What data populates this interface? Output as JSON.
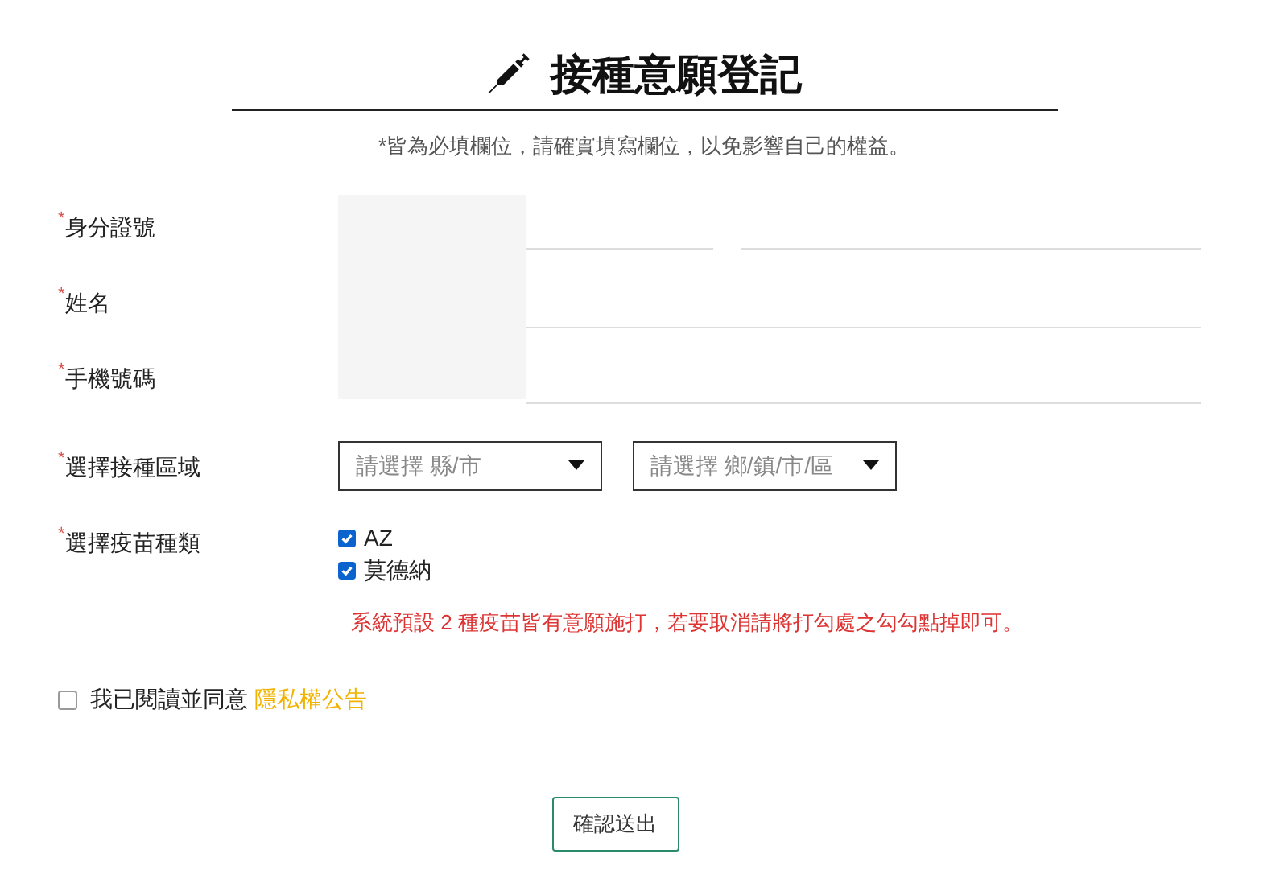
{
  "title": "接種意願登記",
  "notice": "*皆為必填欄位，請確實填寫欄位，以免影響自己的權益。",
  "fields": [
    {
      "kind": "split",
      "required_mark": "*",
      "label": "身分證號"
    },
    {
      "kind": "text",
      "required_mark": "*",
      "label": "姓名"
    },
    {
      "kind": "text",
      "required_mark": "*",
      "label": "手機號碼"
    }
  ],
  "region": {
    "required_mark": "*",
    "label": "選擇接種區域",
    "selects": [
      {
        "placeholder": "請選擇 縣/市"
      },
      {
        "placeholder": "請選擇 鄉/鎮/市/區"
      }
    ]
  },
  "vaccine": {
    "required_mark": "*",
    "label": "選擇疫苗種類",
    "options": [
      {
        "label": "AZ",
        "checked": true
      },
      {
        "label": "莫德納",
        "checked": true
      }
    ],
    "note": "系統預設 2 種疫苗皆有意願施打，若要取消請將打勾處之勾勾點掉即可。"
  },
  "agreement": {
    "checked": false,
    "text": "我已閱讀並同意",
    "link": "隱私權公告"
  },
  "submit": "確認送出"
}
